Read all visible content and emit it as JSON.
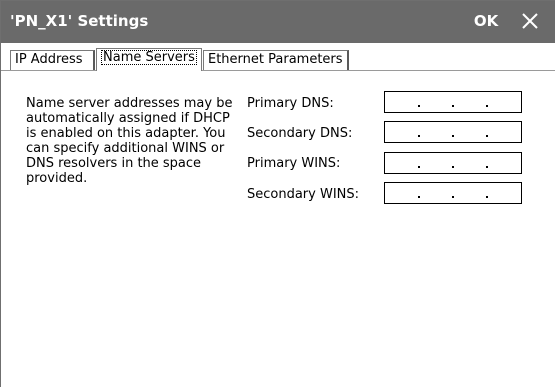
{
  "window": {
    "title": "'PN_X1' Settings",
    "ok_label": "OK",
    "close_icon": "close-icon"
  },
  "tabs": [
    {
      "label": "IP Address",
      "selected": false
    },
    {
      "label": "Name Servers",
      "selected": true
    },
    {
      "label": "Ethernet Parameters",
      "selected": false
    }
  ],
  "main": {
    "description": "Name server addresses may be automatically assigned if DHCP is enabled on this adapter. You can specify additional WINS or DNS resolvers in the space provided.",
    "fields": [
      {
        "label": "Primary DNS:",
        "value": ""
      },
      {
        "label": "Secondary DNS:",
        "value": ""
      },
      {
        "label": "Primary WINS:",
        "value": ""
      },
      {
        "label": "Secondary WINS:",
        "value": ""
      }
    ]
  },
  "colors": {
    "titlebar": "#6a6a6a",
    "title_text": "#ffffff",
    "background": "#ffffff"
  }
}
